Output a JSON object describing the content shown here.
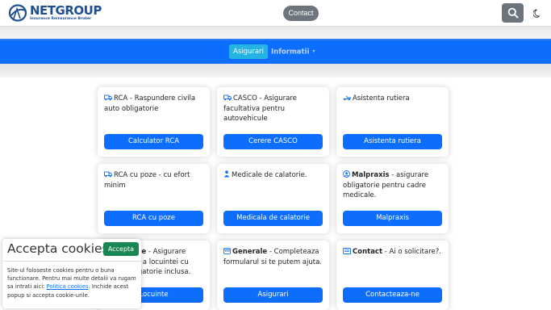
{
  "header": {
    "logo_name": "NETGROUP",
    "logo_tagline": "Insurance Reinsurance Broker",
    "contact_label": "Contact",
    "search_icon": "search-icon",
    "theme_icon": "moon-icon"
  },
  "nav": {
    "active_label": "Asigurari",
    "dropdown_label": "Informatii",
    "caret": "▾"
  },
  "cards": [
    {
      "icon": "truck-icon",
      "title_bold": "",
      "title": "RCA - Raspundere civila auto obligatorie",
      "button": "Calculator RCA"
    },
    {
      "icon": "car-icon",
      "title_bold": "",
      "title": "CASCO - Asigurare facultativa pentru autovehicule",
      "button": "Cerere CASCO"
    },
    {
      "icon": "tow-truck-icon",
      "title_bold": "",
      "title": "Asistenta rutiera",
      "button": "Asistenta rutiera"
    },
    {
      "icon": "truck-icon",
      "title_bold": "",
      "title": "RCA cu poze - cu efort minim",
      "button": "RCA cu poze"
    },
    {
      "icon": "person-icon",
      "title_bold": "",
      "title": "Medicale de calatorie.",
      "button": "Medicala de calatorie"
    },
    {
      "icon": "user-circle-icon",
      "title_bold": "Malpraxis",
      "title": " - asigurare obligatorie pentru cadre medicale.",
      "button": "Malpraxis"
    },
    {
      "icon": "house-icon",
      "title_bold": "Locuinte",
      "title": " - Asigurare facultativa a locuintei cu polita obligatorie inclusa.",
      "button": "Locuinte"
    },
    {
      "icon": "calendar-icon",
      "title_bold": "Generale",
      "title": " - Completeaza formularul si te putem ajuta.",
      "button": "Asigurari"
    },
    {
      "icon": "address-card-icon",
      "title_bold": "Contact",
      "title": " - Ai o solicitare?.",
      "button": "Contacteaza-ne"
    }
  ],
  "cookie": {
    "title": "Accepta cookies",
    "accept_label": "Accepta",
    "body_before": "Site-ul foloseste cookies pentru o buna functionare. Pentru mai multe detalii va rugam sa intrati aici: ",
    "link_text": "Politica cookies",
    "body_after": ". Inchide acest popup si accepta cookie-urile."
  },
  "colors": {
    "primary": "#0d6efd",
    "nav_active": "#25b3e4",
    "accept": "#198754",
    "pill": "#6c757d",
    "logo": "#1f4f8f"
  }
}
